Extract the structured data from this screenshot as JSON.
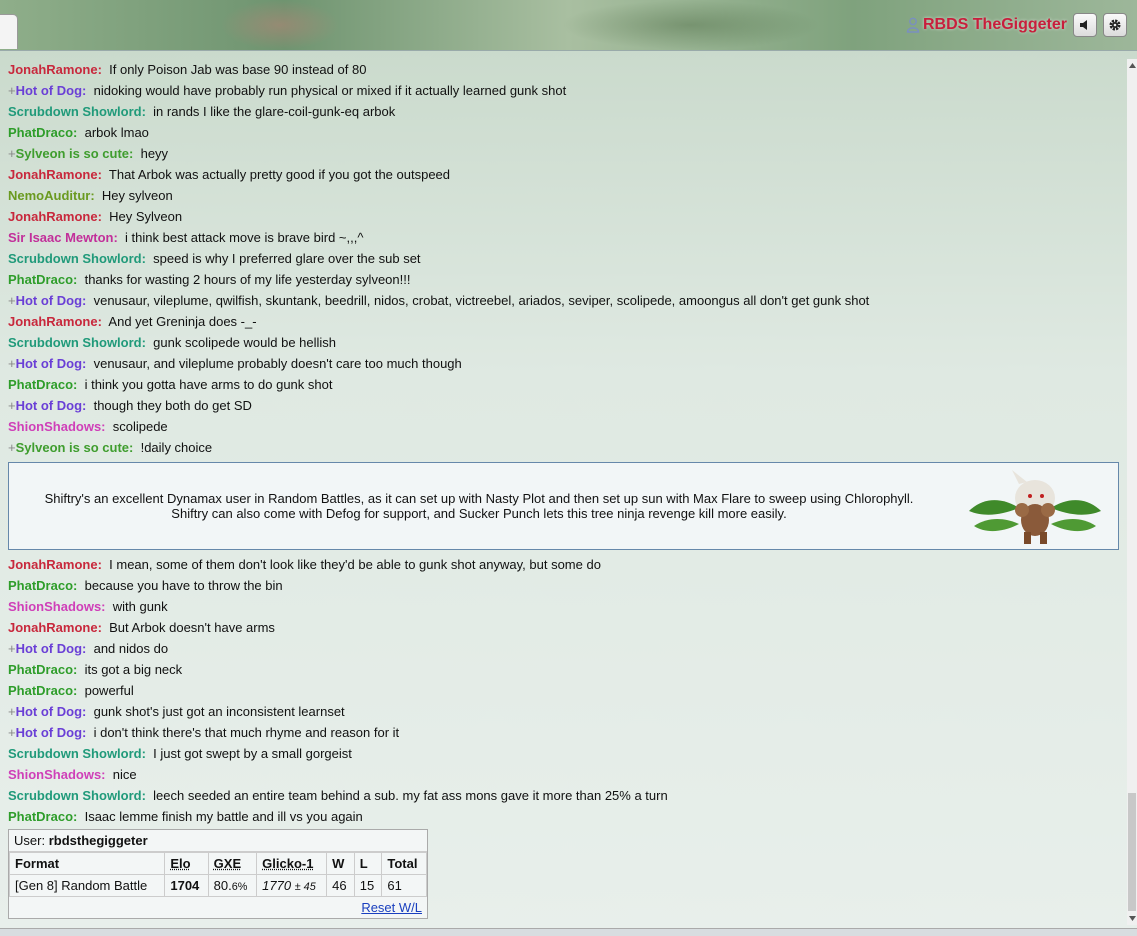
{
  "header": {
    "username": "RBDS TheGiggeter"
  },
  "colors": {
    "jonah": "#c8283c",
    "hotdog": "#6a3fd6",
    "scrub": "#209a7a",
    "phat": "#2e9d2a",
    "sylveon": "#3f9d2e",
    "nemo": "#6a9a20",
    "isaac": "#c22f9a",
    "shion": "#cf3fb8"
  },
  "messages_before": [
    {
      "rank": "",
      "name": "JonahRamone:",
      "color": "jonah",
      "text": "If only Poison Jab was base 90 instead of 80"
    },
    {
      "rank": "+",
      "name": "Hot of Dog:",
      "color": "hotdog",
      "text": "nidoking would have probably run physical or mixed if it actually learned gunk shot"
    },
    {
      "rank": "",
      "name": "Scrubdown Showlord:",
      "color": "scrub",
      "text": "in rands I like the glare-coil-gunk-eq arbok"
    },
    {
      "rank": "",
      "name": "PhatDraco:",
      "color": "phat",
      "text": "arbok lmao"
    },
    {
      "rank": "+",
      "name": "Sylveon is so cute:",
      "color": "sylveon",
      "text": "heyy"
    },
    {
      "rank": "",
      "name": "JonahRamone:",
      "color": "jonah",
      "text": "That Arbok was actually pretty good if you got the outspeed"
    },
    {
      "rank": "",
      "name": "NemoAuditur:",
      "color": "nemo",
      "text": "Hey sylveon"
    },
    {
      "rank": "",
      "name": "JonahRamone:",
      "color": "jonah",
      "text": "Hey Sylveon"
    },
    {
      "rank": "",
      "name": "Sir Isaac Mewton:",
      "color": "isaac",
      "text": "i think best attack move is brave bird ~,,,^"
    },
    {
      "rank": "",
      "name": "Scrubdown Showlord:",
      "color": "scrub",
      "text": "speed is why I preferred glare over the sub set"
    },
    {
      "rank": "",
      "name": "PhatDraco:",
      "color": "phat",
      "text": "thanks for wasting 2 hours of my life yesterday sylveon!!!"
    },
    {
      "rank": "+",
      "name": "Hot of Dog:",
      "color": "hotdog",
      "text": "venusaur, vileplume, qwilfish, skuntank, beedrill, nidos, crobat, victreebel, ariados, seviper, scolipede, amoongus all don't get gunk shot"
    },
    {
      "rank": "",
      "name": "JonahRamone:",
      "color": "jonah",
      "text": "And yet Greninja does -_-"
    },
    {
      "rank": "",
      "name": "Scrubdown Showlord:",
      "color": "scrub",
      "text": "gunk scolipede would be hellish"
    },
    {
      "rank": "+",
      "name": "Hot of Dog:",
      "color": "hotdog",
      "text": "venusaur, and vileplume probably doesn't care too much though"
    },
    {
      "rank": "",
      "name": "PhatDraco:",
      "color": "phat",
      "text": "i think you gotta have arms to do gunk shot"
    },
    {
      "rank": "+",
      "name": "Hot of Dog:",
      "color": "hotdog",
      "text": "though they both do get SD"
    },
    {
      "rank": "",
      "name": "ShionShadows:",
      "color": "shion",
      "text": "scolipede"
    },
    {
      "rank": "+",
      "name": "Sylveon is so cute:",
      "color": "sylveon",
      "text": "!daily choice"
    }
  ],
  "infobox": {
    "text": "Shiftry's an excellent Dynamax user in Random Battles, as it can set up with Nasty Plot and then set up sun with Max Flare to sweep using Chlorophyll. Shiftry can also come with Defog for support, and Sucker Punch lets this tree ninja revenge kill more easily."
  },
  "messages_after": [
    {
      "rank": "",
      "name": "JonahRamone:",
      "color": "jonah",
      "text": "I mean, some of them don't look like they'd be able to gunk shot anyway, but some do"
    },
    {
      "rank": "",
      "name": "PhatDraco:",
      "color": "phat",
      "text": "because you have to throw the bin"
    },
    {
      "rank": "",
      "name": "ShionShadows:",
      "color": "shion",
      "text": "with gunk"
    },
    {
      "rank": "",
      "name": "JonahRamone:",
      "color": "jonah",
      "text": "But Arbok doesn't have arms"
    },
    {
      "rank": "+",
      "name": "Hot of Dog:",
      "color": "hotdog",
      "text": "and nidos do"
    },
    {
      "rank": "",
      "name": "PhatDraco:",
      "color": "phat",
      "text": "its got a big neck"
    },
    {
      "rank": "",
      "name": "PhatDraco:",
      "color": "phat",
      "text": "powerful"
    },
    {
      "rank": "+",
      "name": "Hot of Dog:",
      "color": "hotdog",
      "text": "gunk shot's just got an inconsistent learnset"
    },
    {
      "rank": "+",
      "name": "Hot of Dog:",
      "color": "hotdog",
      "text": "i don't think there's that much rhyme and reason for it"
    },
    {
      "rank": "",
      "name": "Scrubdown Showlord:",
      "color": "scrub",
      "text": "I just got swept by a small gorgeist"
    },
    {
      "rank": "",
      "name": "ShionShadows:",
      "color": "shion",
      "text": "nice"
    },
    {
      "rank": "",
      "name": "Scrubdown Showlord:",
      "color": "scrub",
      "text": "leech seeded an entire team behind a sub. my fat ass mons gave it more than 25% a turn"
    },
    {
      "rank": "",
      "name": "PhatDraco:",
      "color": "phat",
      "text": "Isaac lemme finish my battle and ill vs you again"
    }
  ],
  "ladder": {
    "user_label": "User:",
    "user": "rbdsthegiggeter",
    "headers": [
      "Format",
      "Elo",
      "GXE",
      "Glicko-1",
      "W",
      "L",
      "Total"
    ],
    "row": {
      "format": "[Gen 8] Random Battle",
      "elo": "1704",
      "gxe_main": "80.",
      "gxe_small": "6%",
      "glicko_main": "1770",
      "glicko_small": "± 45",
      "w": "46",
      "l": "15",
      "total": "61"
    },
    "reset": "Reset W/L"
  }
}
